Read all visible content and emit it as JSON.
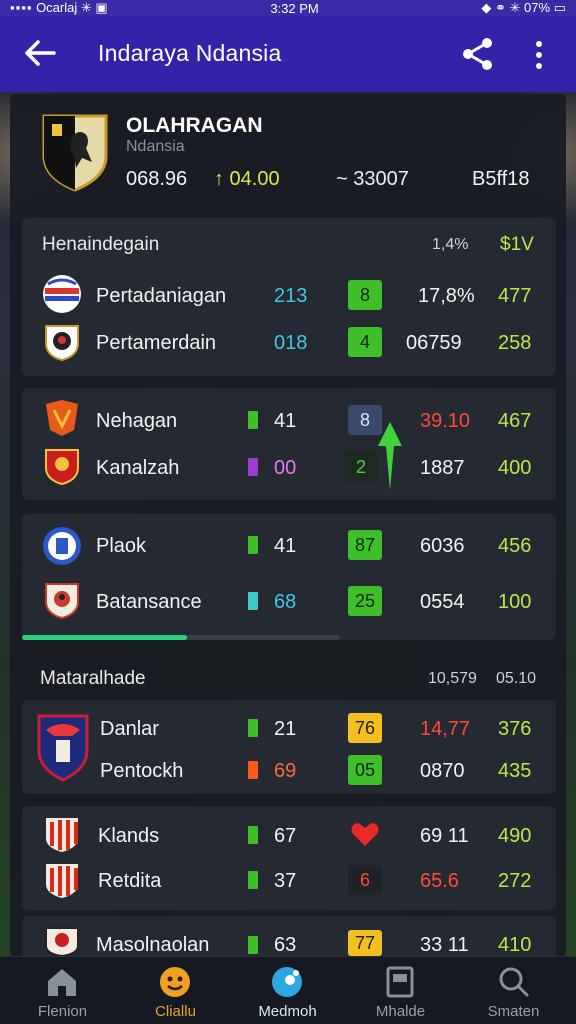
{
  "status": {
    "carrier": "Ocarlaj",
    "time": "3:32 PM",
    "battery": "07%"
  },
  "appbar": {
    "title": "Indaraya Ndansia"
  },
  "team": {
    "name": "OLAHRAGAN",
    "subtitle": "Ndansia",
    "stat1": "068.96",
    "stat2": "↑ 04.00",
    "stat3": "~ 33007",
    "stat4": "B5ff18"
  },
  "section1": {
    "title": "Henaindegain",
    "col1": "1,4%",
    "col2": "$1V",
    "rows": [
      {
        "name": "Pertadaniagan",
        "a": "213",
        "chip": "8",
        "b": "17,8%",
        "c": "477"
      },
      {
        "name": "Pertamerdain",
        "a": "018",
        "chip": "4",
        "b": "06759",
        "c": "258"
      }
    ]
  },
  "section2": {
    "rows": [
      {
        "name": "Nehagan",
        "a": "41",
        "chip": "8",
        "b": "39.10",
        "c": "467"
      },
      {
        "name": "Kanalzah",
        "a": "00",
        "chip": "2",
        "b": "1887",
        "c": "400"
      }
    ]
  },
  "section3": {
    "rows": [
      {
        "name": "Plaok",
        "a": "41",
        "chip": "87",
        "b": "6036",
        "c": "456"
      },
      {
        "name": "Batansance",
        "a": "68",
        "chip": "25",
        "b": "0554",
        "c": "100"
      }
    ],
    "progress": 0.52
  },
  "section4": {
    "title": "Mataralhade",
    "col1": "10,579",
    "col2": "05.10",
    "rows": [
      {
        "name": "Danlar",
        "a": "21",
        "chip": "76",
        "b": "14,77",
        "c": "376"
      },
      {
        "name": "Pentockh",
        "a": "69",
        "chip": "05",
        "b": "0870",
        "c": "435"
      }
    ]
  },
  "section5": {
    "rows": [
      {
        "name": "Klands",
        "a": "67",
        "chip": "",
        "b": "69 11",
        "c": "490"
      },
      {
        "name": "Retdita",
        "a": "37",
        "chip": "6",
        "b": "65.6",
        "c": "272"
      }
    ]
  },
  "section6": {
    "rows": [
      {
        "name": "Masolnaolan",
        "a": "63",
        "chip": "77",
        "b": "33 11",
        "c": "410"
      }
    ]
  },
  "nav": [
    {
      "label": "Flenion"
    },
    {
      "label": "Cliallu"
    },
    {
      "label": "Medmoh"
    },
    {
      "label": "Mhalde"
    },
    {
      "label": "Smaten"
    }
  ],
  "colors": {
    "appbar": "#3422a8",
    "green": "#7fe02a",
    "cyan": "#3ec9e6",
    "orange": "#f0a020",
    "red": "#ff4a3a"
  }
}
